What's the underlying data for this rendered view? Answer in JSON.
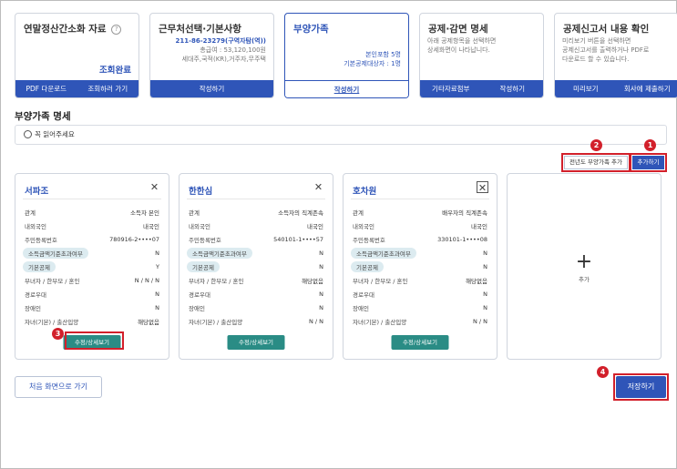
{
  "steps": [
    {
      "title": "연말정산간소화 자료",
      "help": "?",
      "status": "조회완료",
      "buttons": [
        "PDF 다운로드",
        "조회하러 가기"
      ]
    },
    {
      "title": "근무처선택·기본사항",
      "line1": "211-86-23279(구역자탐(역))",
      "line2": "총급여 : 53,120,100원",
      "line3": "세대주,국적(KR),거주자,무주택",
      "buttons": [
        "작성하기"
      ]
    },
    {
      "title": "부양가족",
      "line1": "본인포함 5명",
      "line2": "기본공제대상자 : 1명",
      "buttons": [
        "작성하기"
      ]
    },
    {
      "title": "공제·감면 명세",
      "line1": "아래 공제항목을 선택하면",
      "line2": "상세화면이 나타납니다.",
      "buttons": [
        "기타자료첨부",
        "작성하기"
      ]
    },
    {
      "title": "공제신고서 내용 확인",
      "line1": "미리보기 버튼을 선택하면",
      "line2": "공제신고서를 출력하거나 PDF로",
      "line3": "다운로드 할 수 있습니다.",
      "buttons": [
        "미리보기",
        "회사에 제출하기"
      ]
    }
  ],
  "section_title": "부양가족 명세",
  "notice": "꼭 읽어주세요",
  "prev_year_button": "전년도 부양가족 추가",
  "add_button": "추가하기",
  "cards": [
    {
      "name": "서파조",
      "rows": [
        {
          "k": "관계",
          "v": "소득자 본인",
          "hl": false
        },
        {
          "k": "내외국인",
          "v": "내국인",
          "hl": false
        },
        {
          "k": "주민등록번호",
          "v": "780916-2••••07",
          "hl": false
        },
        {
          "k": "소득금액기준초과여부",
          "v": "N",
          "hl": true
        },
        {
          "k": "기본공제",
          "v": "Y",
          "hl": true
        },
        {
          "k": "부녀자 / 한부모 / 혼인",
          "v": "N / N / N",
          "hl": false
        },
        {
          "k": "경로우대",
          "v": "N",
          "hl": false
        },
        {
          "k": "장애인",
          "v": "N",
          "hl": false
        },
        {
          "k": "자녀(기본) / 출산입양",
          "v": "해당없음",
          "hl": false
        }
      ],
      "button": "수정/상세보기"
    },
    {
      "name": "한한심",
      "rows": [
        {
          "k": "관계",
          "v": "소득자의 직계존속",
          "hl": false
        },
        {
          "k": "내외국인",
          "v": "내국인",
          "hl": false
        },
        {
          "k": "주민등록번호",
          "v": "540101-1••••57",
          "hl": false
        },
        {
          "k": "소득금액기준초과여부",
          "v": "N",
          "hl": true
        },
        {
          "k": "기본공제",
          "v": "N",
          "hl": true
        },
        {
          "k": "부녀자 / 한부모 / 혼인",
          "v": "해당없음",
          "hl": false
        },
        {
          "k": "경로우대",
          "v": "N",
          "hl": false
        },
        {
          "k": "장애인",
          "v": "N",
          "hl": false
        },
        {
          "k": "자녀(기본) / 출산입양",
          "v": "N / N",
          "hl": false
        }
      ],
      "button": "수정/상세보기"
    },
    {
      "name": "호차원",
      "rows": [
        {
          "k": "관계",
          "v": "배우자의 직계존속",
          "hl": false
        },
        {
          "k": "내외국인",
          "v": "내국인",
          "hl": false
        },
        {
          "k": "주민등록번호",
          "v": "330101-1••••08",
          "hl": false
        },
        {
          "k": "소득금액기준초과여부",
          "v": "N",
          "hl": true
        },
        {
          "k": "기본공제",
          "v": "N",
          "hl": true
        },
        {
          "k": "부녀자 / 한부모 / 혼인",
          "v": "해당없음",
          "hl": false
        },
        {
          "k": "경로우대",
          "v": "N",
          "hl": false
        },
        {
          "k": "장애인",
          "v": "N",
          "hl": false
        },
        {
          "k": "자녀(기본) / 출산입양",
          "v": "N / N",
          "hl": false
        }
      ],
      "button": "수정/상세보기"
    }
  ],
  "add_card": {
    "plus": "+",
    "label": "추가"
  },
  "home_button": "처음 화면으로 가기",
  "save_button": "저장하기",
  "callouts": [
    "1",
    "2",
    "3",
    "4"
  ],
  "colors": {
    "primary": "#2f55b8",
    "teal": "#2a8c85",
    "callout_red": "#d2202b",
    "highlight": "#dcebf0"
  }
}
